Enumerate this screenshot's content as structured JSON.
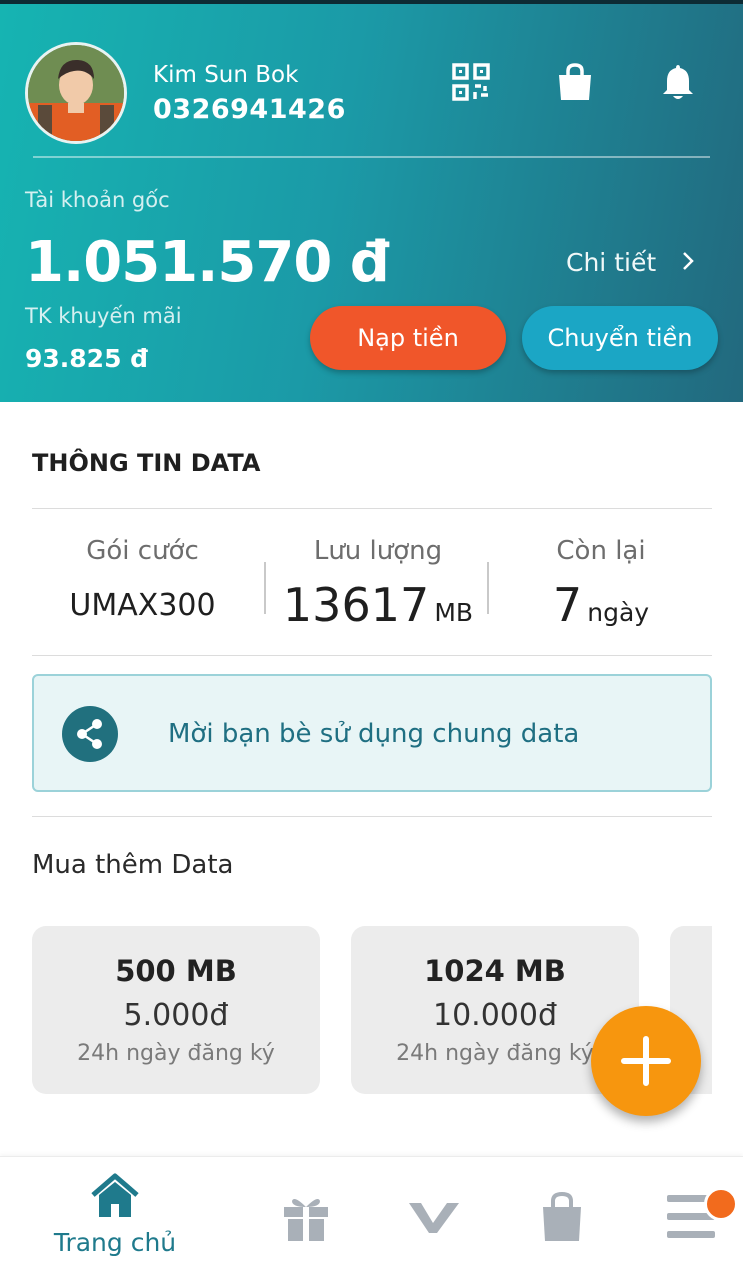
{
  "header": {
    "user_name": "Kim Sun Bok",
    "phone": "0326941426",
    "icons": [
      "qr-code-icon",
      "shopping-bag-icon",
      "bell-icon"
    ],
    "main_account_label": "Tài khoản gốc",
    "main_balance": "1.051.570 đ",
    "detail_label": "Chi tiết",
    "promo_account_label": "TK khuyến mãi",
    "promo_balance": "93.825 đ",
    "topup_label": "Nạp tiền",
    "transfer_label": "Chuyển tiền"
  },
  "data_info": {
    "section_title": "THÔNG TIN DATA",
    "plan_label": "Gói cước",
    "plan_value": "UMAX300",
    "volume_label": "Lưu lượng",
    "volume_value": "13617",
    "volume_unit": "MB",
    "remaining_label": "Còn lại",
    "remaining_value": "7",
    "remaining_unit": "ngày"
  },
  "share": {
    "label": "Mời bạn bè sử dụng chung data",
    "icon": "share-icon"
  },
  "buy_more": {
    "title": "Mua thêm Data",
    "packages": [
      {
        "size": "500 MB",
        "price": "5.000đ",
        "validity": "24h ngày đăng ký"
      },
      {
        "size": "1024 MB",
        "price": "10.000đ",
        "validity": "24h ngày đăng ký"
      }
    ]
  },
  "bottom_nav": {
    "items": [
      {
        "label": "Trang chủ",
        "icon": "home-icon",
        "active": true
      },
      {
        "label": "",
        "icon": "gift-icon"
      },
      {
        "label": "",
        "icon": "brand-v-icon"
      },
      {
        "label": "",
        "icon": "shopping-bag-icon"
      },
      {
        "label": "",
        "icon": "menu-icon"
      }
    ]
  },
  "colors": {
    "header_gradient_start": "#16b4b2",
    "header_gradient_end": "#22697e",
    "topup_button": "#f0562a",
    "transfer_button": "#1ba6c5",
    "fab": "#f7960e",
    "accent_teal": "#1f7a8c",
    "notification_dot": "#f26b1d"
  }
}
